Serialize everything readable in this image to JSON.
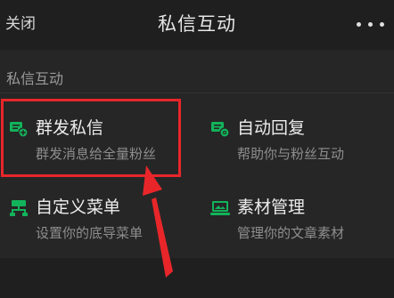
{
  "nav": {
    "close_label": "关闭",
    "title": "私信互动"
  },
  "section": {
    "label": "私信互动"
  },
  "menu": {
    "items": [
      {
        "title": "群发私信",
        "desc": "群发消息给全量粉丝",
        "icon": "mass-message-icon"
      },
      {
        "title": "自动回复",
        "desc": "帮助你与粉丝互动",
        "icon": "auto-reply-icon"
      },
      {
        "title": "自定义菜单",
        "desc": "设置你的底导菜单",
        "icon": "custom-menu-icon"
      },
      {
        "title": "素材管理",
        "desc": "管理你的文章素材",
        "icon": "material-management-icon"
      }
    ]
  },
  "colors": {
    "background": "#262626",
    "accent_green": "#12b35a",
    "highlight_red": "#e8262a"
  }
}
